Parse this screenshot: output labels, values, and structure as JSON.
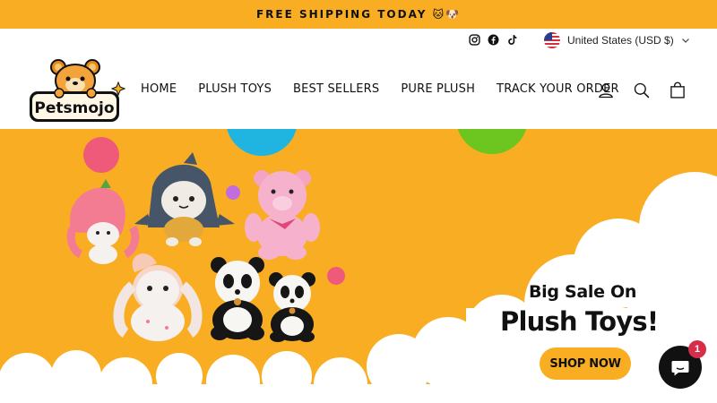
{
  "announcement": {
    "text": "FREE SHIPPING TODAY 🐱🐶"
  },
  "utility": {
    "social": [
      "instagram-icon",
      "facebook-icon",
      "tiktok-icon"
    ],
    "currency_label": "United States (USD $)"
  },
  "header": {
    "logo_text": "Petsmojo",
    "nav": [
      "HOME",
      "PLUSH TOYS",
      "BEST SELLERS",
      "PURE PLUSH",
      "TRACK YOUR ORDER"
    ],
    "icons": [
      "account-icon",
      "search-icon",
      "cart-icon"
    ]
  },
  "hero": {
    "title_line1": "Big Sale On",
    "title_line2": "Plush Toys!",
    "button_label": "SHOP NOW"
  },
  "chat": {
    "badge_count": "1"
  },
  "colors": {
    "accent": "#f9ad22",
    "badge": "#d62d4b",
    "pink": "#ef5a7a",
    "blue": "#20b5e0",
    "green": "#6cc61f",
    "purple": "#c16de0"
  }
}
